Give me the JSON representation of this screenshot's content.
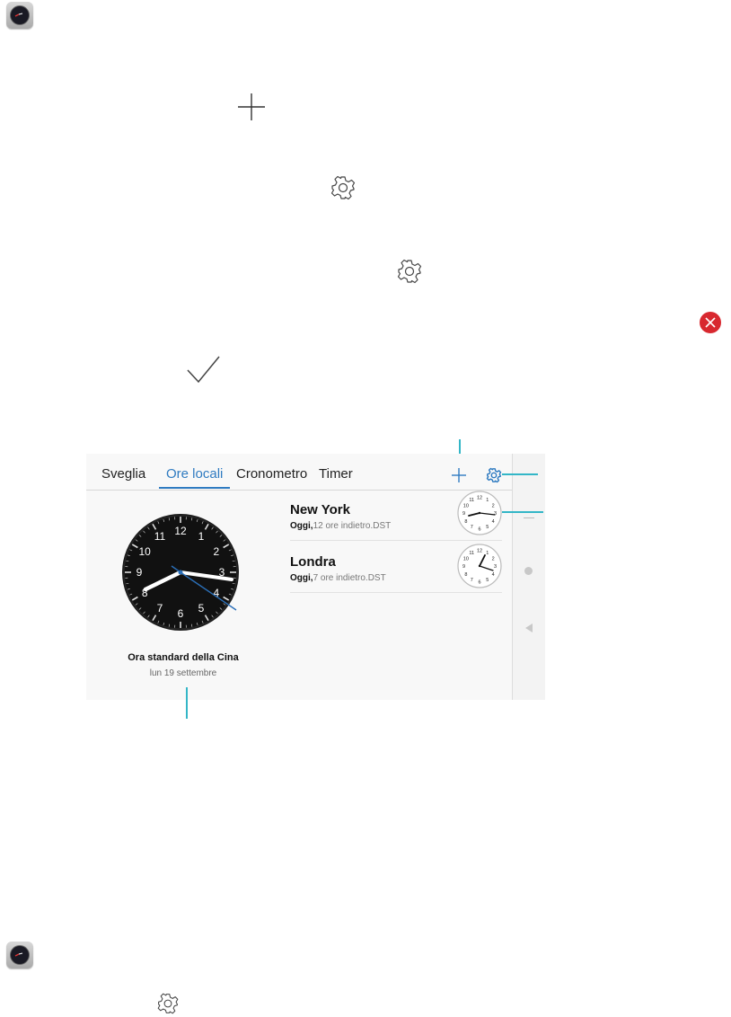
{
  "page": {
    "icons": {
      "app_icon": "clock-app-icon",
      "add": "plus-icon",
      "settings": "gear-icon",
      "delete": "delete-red-icon",
      "confirm": "checkmark-icon"
    },
    "colors": {
      "accent": "#2f7bc1",
      "callout": "#33b6c7",
      "delete_red": "#d8282f"
    }
  },
  "screenshot": {
    "tabs": [
      {
        "label": "Sveglia"
      },
      {
        "label": "Ore locali"
      },
      {
        "label": "Cronometro"
      },
      {
        "label": "Timer"
      }
    ],
    "active_tab": "Ore locali",
    "cities": [
      {
        "name": "New York",
        "day": "Oggi,",
        "offset": "12 ore indietro.DST"
      },
      {
        "name": "Londra",
        "day": "Oggi,",
        "offset": "7 ore indietro.DST"
      }
    ],
    "main_clock": {
      "timezone": "Ora standard della Cina",
      "date": "lun 19 settembre",
      "numerals": [
        "12",
        "1",
        "2",
        "3",
        "4",
        "5",
        "6",
        "7",
        "8",
        "9",
        "10",
        "11"
      ]
    },
    "small_clock_numerals": [
      "12",
      "1",
      "2",
      "3",
      "4",
      "5",
      "6",
      "7",
      "8",
      "9",
      "10",
      "11"
    ]
  }
}
